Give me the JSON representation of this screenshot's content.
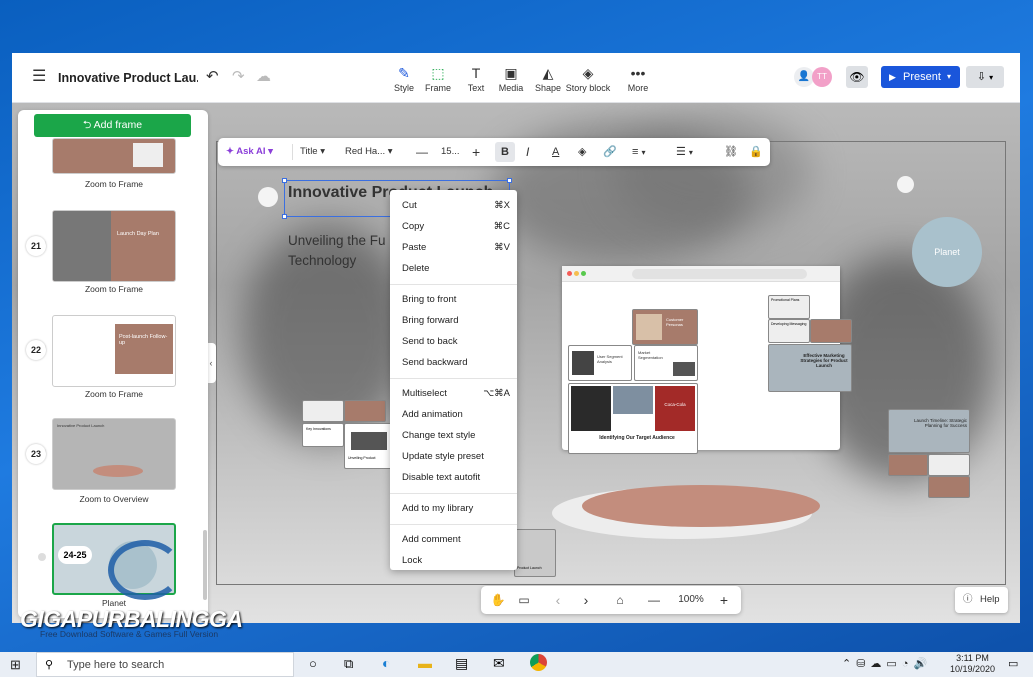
{
  "app": {
    "title": "Innovative Product Lau...",
    "tools": [
      {
        "icon": "pen-icon",
        "label": "Style",
        "glyph": "✎"
      },
      {
        "icon": "frame-icon",
        "label": "Frame",
        "glyph": "⬚"
      },
      {
        "icon": "text-icon",
        "label": "Text",
        "glyph": "T"
      },
      {
        "icon": "media-icon",
        "label": "Media",
        "glyph": "▣"
      },
      {
        "icon": "shape-icon",
        "label": "Shape",
        "glyph": "◭"
      },
      {
        "icon": "story-block-icon",
        "label": "Story block",
        "glyph": "◈"
      },
      {
        "icon": "more-icon",
        "label": "More",
        "glyph": "•••"
      }
    ],
    "avatar_initials": "TT",
    "present_label": "Present",
    "accent_color": "#1a73e8"
  },
  "sidebar": {
    "add_frame_label": "Add frame",
    "frames": [
      {
        "label": "Zoom to Frame"
      },
      {
        "number": "21",
        "title": "Launch Day Plan",
        "label": "Zoom to Frame"
      },
      {
        "number": "22",
        "title": "Post-launch Follow-up",
        "label": "Zoom to Frame"
      },
      {
        "number": "23",
        "title": "Innovative Product Launch",
        "label": "Zoom to Overview"
      },
      {
        "number": "24-25",
        "label": "Planet"
      }
    ]
  },
  "format_bar": {
    "ask_ai": "Ask AI",
    "style": "Title",
    "font": "Red Ha...",
    "size": "15..."
  },
  "canvas": {
    "title": "Innovative Product Launch",
    "subtitle_line1": "Unveiling the Fu",
    "subtitle_line2": "Technology",
    "planet_label": "Planet",
    "frames": {
      "customer_personas": "Customer Personas",
      "user_segment": "User Segment Analysis",
      "market_segmentation": "Market Segmentation",
      "target_audience": "Identifying Our Target Audience",
      "promotional_plans": "Promotional Plans",
      "developing_messaging": "Developing Messaging",
      "effective_marketing": "Effective Marketing Strategies for Product Launch",
      "launch_timeline": "Launch Timeline: Strategic Planning for Success",
      "key_innovations": "Key Innovations",
      "unveiling_product": "Unveiling Product",
      "product_launch": "Product Launch",
      "coca_cola": "Coca-Cola"
    }
  },
  "context_menu": {
    "groups": [
      [
        {
          "label": "Cut",
          "shortcut": "⌘X"
        },
        {
          "label": "Copy",
          "shortcut": "⌘C"
        },
        {
          "label": "Paste",
          "shortcut": "⌘V"
        },
        {
          "label": "Delete",
          "shortcut": ""
        }
      ],
      [
        {
          "label": "Bring to front",
          "shortcut": ""
        },
        {
          "label": "Bring forward",
          "shortcut": ""
        },
        {
          "label": "Send to back",
          "shortcut": ""
        },
        {
          "label": "Send backward",
          "shortcut": ""
        }
      ],
      [
        {
          "label": "Multiselect",
          "shortcut": "⌥⌘A"
        },
        {
          "label": "Add animation",
          "shortcut": ""
        },
        {
          "label": "Change text style",
          "shortcut": ""
        },
        {
          "label": "Update style preset",
          "shortcut": ""
        },
        {
          "label": "Disable text autofit",
          "shortcut": ""
        }
      ],
      [
        {
          "label": "Add to my library",
          "shortcut": ""
        }
      ],
      [
        {
          "label": "Add comment",
          "shortcut": ""
        },
        {
          "label": "Lock",
          "shortcut": ""
        }
      ]
    ]
  },
  "bottom_bar": {
    "zoom": "100%"
  },
  "help_label": "Help",
  "watermark": {
    "title": "GIGAPURBALINGGA",
    "subtitle": "Free Download Software & Games Full Version"
  },
  "taskbar": {
    "search_placeholder": "Type here to search",
    "time": "3:11 PM",
    "date": "10/19/2020"
  }
}
